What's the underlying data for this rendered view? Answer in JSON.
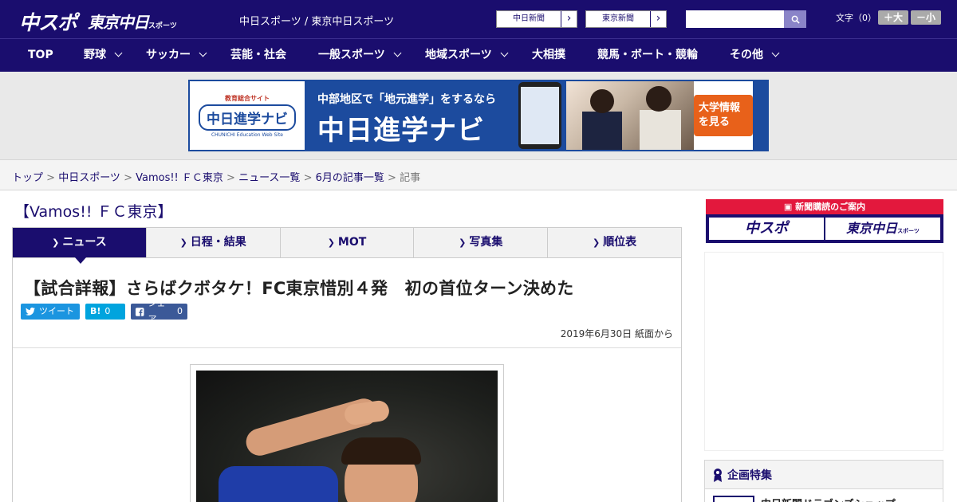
{
  "header": {
    "logo_main": "中スポ",
    "logo_sub": "東京中日",
    "logo_sub_small": "スポーツ",
    "site_names": "中日スポーツ / 東京中日スポーツ",
    "ext_links": [
      {
        "label": "中日新聞"
      },
      {
        "label": "東京新聞"
      }
    ],
    "search": {
      "placeholder": "",
      "value": ""
    },
    "font_size_label": "文字（0）",
    "font_up": "＋大",
    "font_down": "－小"
  },
  "nav": {
    "items": [
      {
        "label": "TOP"
      },
      {
        "label": "野球"
      },
      {
        "label": "サッカー"
      },
      {
        "label": "芸能・社会"
      },
      {
        "label": "一般スポーツ"
      },
      {
        "label": "地域スポーツ"
      },
      {
        "label": "大相撲"
      },
      {
        "label": "競馬・ボート・競輪"
      },
      {
        "label": "その他"
      }
    ]
  },
  "ad_banner": {
    "logo_small": "教育総合サイト",
    "logo_big": "中日進学ナビ",
    "logo_tiny": "CHUNICHI Education Web Site",
    "line1": "中部地区で「地元進学」をするなら",
    "line2": "中日進学ナビ",
    "cta": "大学情報を見る"
  },
  "breadcrumb": {
    "items": [
      {
        "label": "トップ"
      },
      {
        "label": "中日スポーツ"
      },
      {
        "label": "Vamos!! ＦＣ東京"
      },
      {
        "label": "ニュース一覧"
      },
      {
        "label": "6月の記事一覧"
      }
    ],
    "current": "記事"
  },
  "section": {
    "title": "【Vamos!! ＦＣ東京】"
  },
  "tabs": [
    {
      "label": "ニュース"
    },
    {
      "label": "日程・結果"
    },
    {
      "label": "MOT"
    },
    {
      "label": "写真集"
    },
    {
      "label": "順位表"
    }
  ],
  "article": {
    "headline": "【試合詳報】さらばクボタケ！FC東京惜別４発　初の首位ターン決めた",
    "share": {
      "tweet": "ツイート",
      "hatena_label": "B!",
      "hatena_count": "0",
      "fb_label": "シェア",
      "fb_count": "0"
    },
    "date": "2019年6月30日 紙面から"
  },
  "sidebar": {
    "subscribe_head": "新聞購読のご案内",
    "subscribe_left": "中スポ",
    "subscribe_right": "東京中日",
    "subscribe_right_small": "スポーツ",
    "feature_head": "企画特集",
    "feature_item": "中日新聞ドラゴンズショップ"
  },
  "colors": {
    "brand": "#1a0d6e",
    "accent_red": "#e3183d"
  }
}
